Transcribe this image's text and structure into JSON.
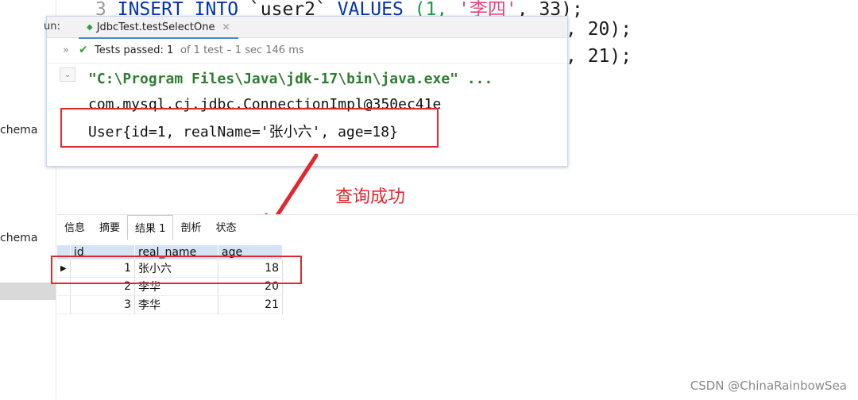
{
  "sidebar": {
    "items": [
      "chema",
      "chema"
    ]
  },
  "sql_lines": [
    {
      "ln": "3",
      "kw1": "INSERT INTO",
      "tbl": "`user2`",
      "kw2": "VALUES",
      "open": "(1,",
      "str": "'李四'",
      "rest": ", 33);"
    },
    {
      "tail": ", 20);"
    },
    {
      "tail": ", 21);"
    }
  ],
  "run_panel": {
    "run_label": "un:",
    "tab_title": "JdbcTest.testSelectOne",
    "status": {
      "passed": "Tests passed: 1",
      "detail": "of 1 test – 1 sec 146 ms"
    },
    "console": [
      "\"C:\\Program Files\\Java\\jdk-17\\bin\\java.exe\" ...",
      "com.mysql.cj.jdbc.ConnectionImpl@350ec41e",
      "User{id=1, realName='张小六', age=18}"
    ]
  },
  "annotation": "查询成功",
  "result": {
    "tabs": [
      "信息",
      "摘要",
      "结果 1",
      "剖析",
      "状态"
    ],
    "active_tab": "结果 1",
    "columns": [
      "id",
      "real_name",
      "age"
    ],
    "rows": [
      {
        "id": "1",
        "real_name": "张小六",
        "age": "18"
      },
      {
        "id": "2",
        "real_name": "李华",
        "age": "20"
      },
      {
        "id": "3",
        "real_name": "李华",
        "age": "21"
      }
    ]
  },
  "watermark": "CSDN @ChinaRainbowSea",
  "colors": {
    "accent_red": "#e0282e",
    "pass_green": "#3c9a3c",
    "header_blue": "#d2e4f5"
  }
}
